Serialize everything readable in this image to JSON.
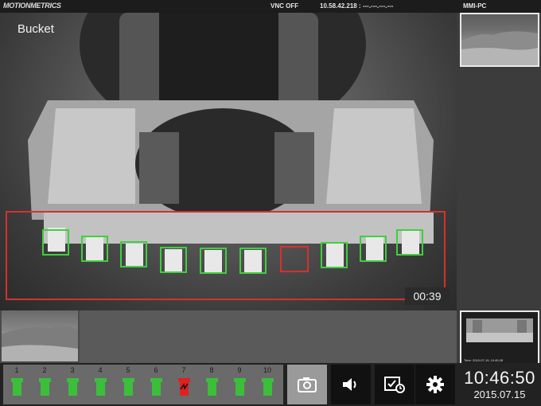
{
  "topbar": {
    "logo": "MOTIONMETRICS",
    "vnc_status": "VNC OFF",
    "address": "10.58.42.218 : ---.---.---.---",
    "pc_name": "MMI-PC"
  },
  "camera": {
    "label": "Bucket",
    "timer": "00:39"
  },
  "thumbnails": {
    "bottom_right_caption": "Time: 2015-07-15, 10:45:28"
  },
  "teeth": [
    {
      "number": "1",
      "status": "ok"
    },
    {
      "number": "2",
      "status": "ok"
    },
    {
      "number": "3",
      "status": "ok"
    },
    {
      "number": "4",
      "status": "ok"
    },
    {
      "number": "5",
      "status": "ok"
    },
    {
      "number": "6",
      "status": "ok"
    },
    {
      "number": "7",
      "status": "missing"
    },
    {
      "number": "8",
      "status": "ok"
    },
    {
      "number": "9",
      "status": "ok"
    },
    {
      "number": "10",
      "status": "ok"
    }
  ],
  "toolbar": {
    "buttons": [
      {
        "icon": "camera-icon",
        "active": true
      },
      {
        "icon": "speaker-icon",
        "active": false
      },
      {
        "icon": "history-icon",
        "active": false
      },
      {
        "icon": "gear-icon",
        "active": false
      }
    ]
  },
  "clock": {
    "time": "10:46:50",
    "date": "2015.07.15"
  },
  "colors": {
    "ok": "#3bbf3b",
    "missing": "#e02020",
    "detection_box": "#e03030"
  }
}
